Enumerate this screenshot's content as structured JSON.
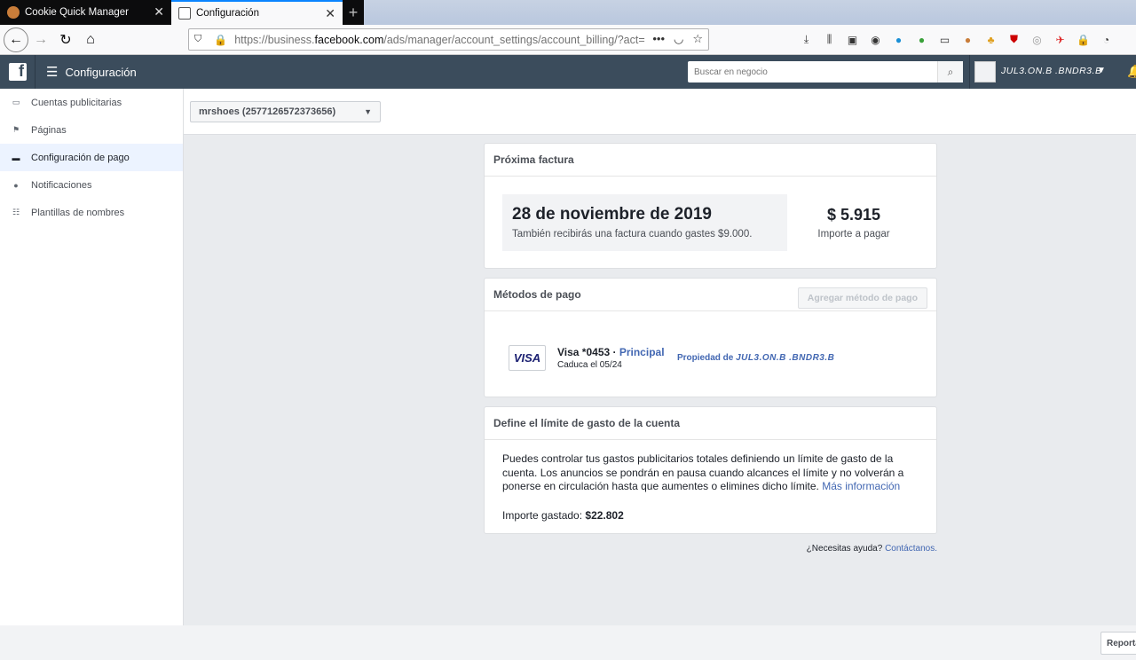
{
  "browser": {
    "tabs": [
      {
        "title": "Cookie Quick Manager",
        "active": false,
        "icon": "cookie-icon"
      },
      {
        "title": "Configuración",
        "active": true,
        "icon": "page-icon"
      }
    ],
    "url": {
      "prefix": "https://business.",
      "host": "facebook.com",
      "path": "/ads/manager/account_settings/account_billing/?act="
    }
  },
  "header": {
    "title": "Configuración",
    "search_placeholder": "Buscar en negocio",
    "user_name": "JUL3.ON.B .BNDR3.B"
  },
  "sidebar": {
    "items": [
      {
        "label": "Cuentas publicitarias",
        "icon": "ad-accounts-icon",
        "active": false
      },
      {
        "label": "Páginas",
        "icon": "flag-icon",
        "active": false
      },
      {
        "label": "Configuración de pago",
        "icon": "credit-card-icon",
        "active": true
      },
      {
        "label": "Notificaciones",
        "icon": "globe-icon",
        "active": false
      },
      {
        "label": "Plantillas de nombres",
        "icon": "templates-icon",
        "active": false
      }
    ]
  },
  "account": {
    "selected": "mrshoes (2577126572373656)"
  },
  "next_invoice": {
    "heading": "Próxima factura",
    "date": "28 de noviembre de 2019",
    "note": "También recibirás una factura cuando gastes $9.000.",
    "amount": "$ 5.915",
    "amount_label": "Importe a pagar"
  },
  "payment_methods": {
    "heading": "Métodos de pago",
    "add_button": "Agregar método de pago",
    "card_brand": "VISA",
    "card_label": "Visa *0453 · ",
    "primary_label": "Principal",
    "expiry": "Caduca el 05/24",
    "owner_prefix": "Propiedad de ",
    "owner_name": "JUL3.ON.B .BNDR3.B"
  },
  "spend_limit": {
    "heading": "Define el límite de gasto de la cuenta",
    "description": "Puedes controlar tus gastos publicitarios totales definiendo un límite de gasto de la cuenta. Los anuncios se pondrán en pausa cuando alcances el límite y no volverán a ponerse en circulación hasta que aumentes o elimines dicho límite. ",
    "more_link": "Más información",
    "spent_label": "Importe gastado: ",
    "spent_value": "$22.802"
  },
  "help": {
    "question": "¿Necesitas ayuda? ",
    "contact": "Contáctanos."
  },
  "footer": {
    "report_button": "Reportar"
  },
  "colors": {
    "header_bg": "#3b4c5c",
    "link": "#4267b2",
    "active_sidebar_bg": "#ecf3ff"
  }
}
